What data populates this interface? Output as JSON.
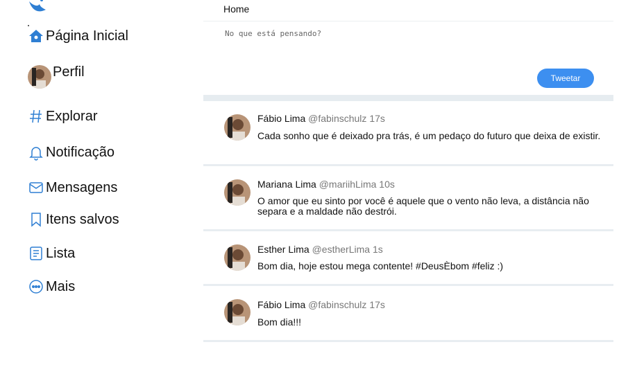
{
  "sidebar": {
    "logo": "bird-logo-icon",
    "items": [
      {
        "label": "Página Inicial",
        "icon": "home-icon"
      },
      {
        "label": "Perfil",
        "icon": "avatar"
      },
      {
        "label": "Explorar",
        "icon": "hashtag-icon"
      },
      {
        "label": "Notificação",
        "icon": "bell-icon"
      },
      {
        "label": "Mensagens",
        "icon": "mail-icon"
      },
      {
        "label": "Itens salvos",
        "icon": "bookmark-icon"
      },
      {
        "label": "Lista",
        "icon": "list-icon"
      },
      {
        "label": "Mais",
        "icon": "more-icon"
      }
    ]
  },
  "header": {
    "title": "Home"
  },
  "compose": {
    "placeholder": "No que está pensando?",
    "button_label": "Tweetar"
  },
  "tweets": [
    {
      "name": "Fábio Lima",
      "handle": "@fabinschulz",
      "time": "17s",
      "text": "Cada sonho que é deixado pra trás, é um pedaço do futuro que deixa de existir."
    },
    {
      "name": "Mariana Lima",
      "handle": "@mariihLima",
      "time": "10s",
      "text": "O amor que eu sinto por você é aquele que o vento não leva, a distância não separa e a maldade não destrói."
    },
    {
      "name": "Esther Lima",
      "handle": "@estherLima",
      "time": "1s",
      "text": "Bom dia, hoje estou mega contente! #DeusÈbom #feliz :)"
    },
    {
      "name": "Fábio Lima",
      "handle": "@fabinschulz",
      "time": "17s",
      "text": "Bom dia!!!"
    }
  ],
  "colors": {
    "accent": "#3d8ff0",
    "icon_blue": "#2f7fd3",
    "divider": "#e6ecf0"
  }
}
